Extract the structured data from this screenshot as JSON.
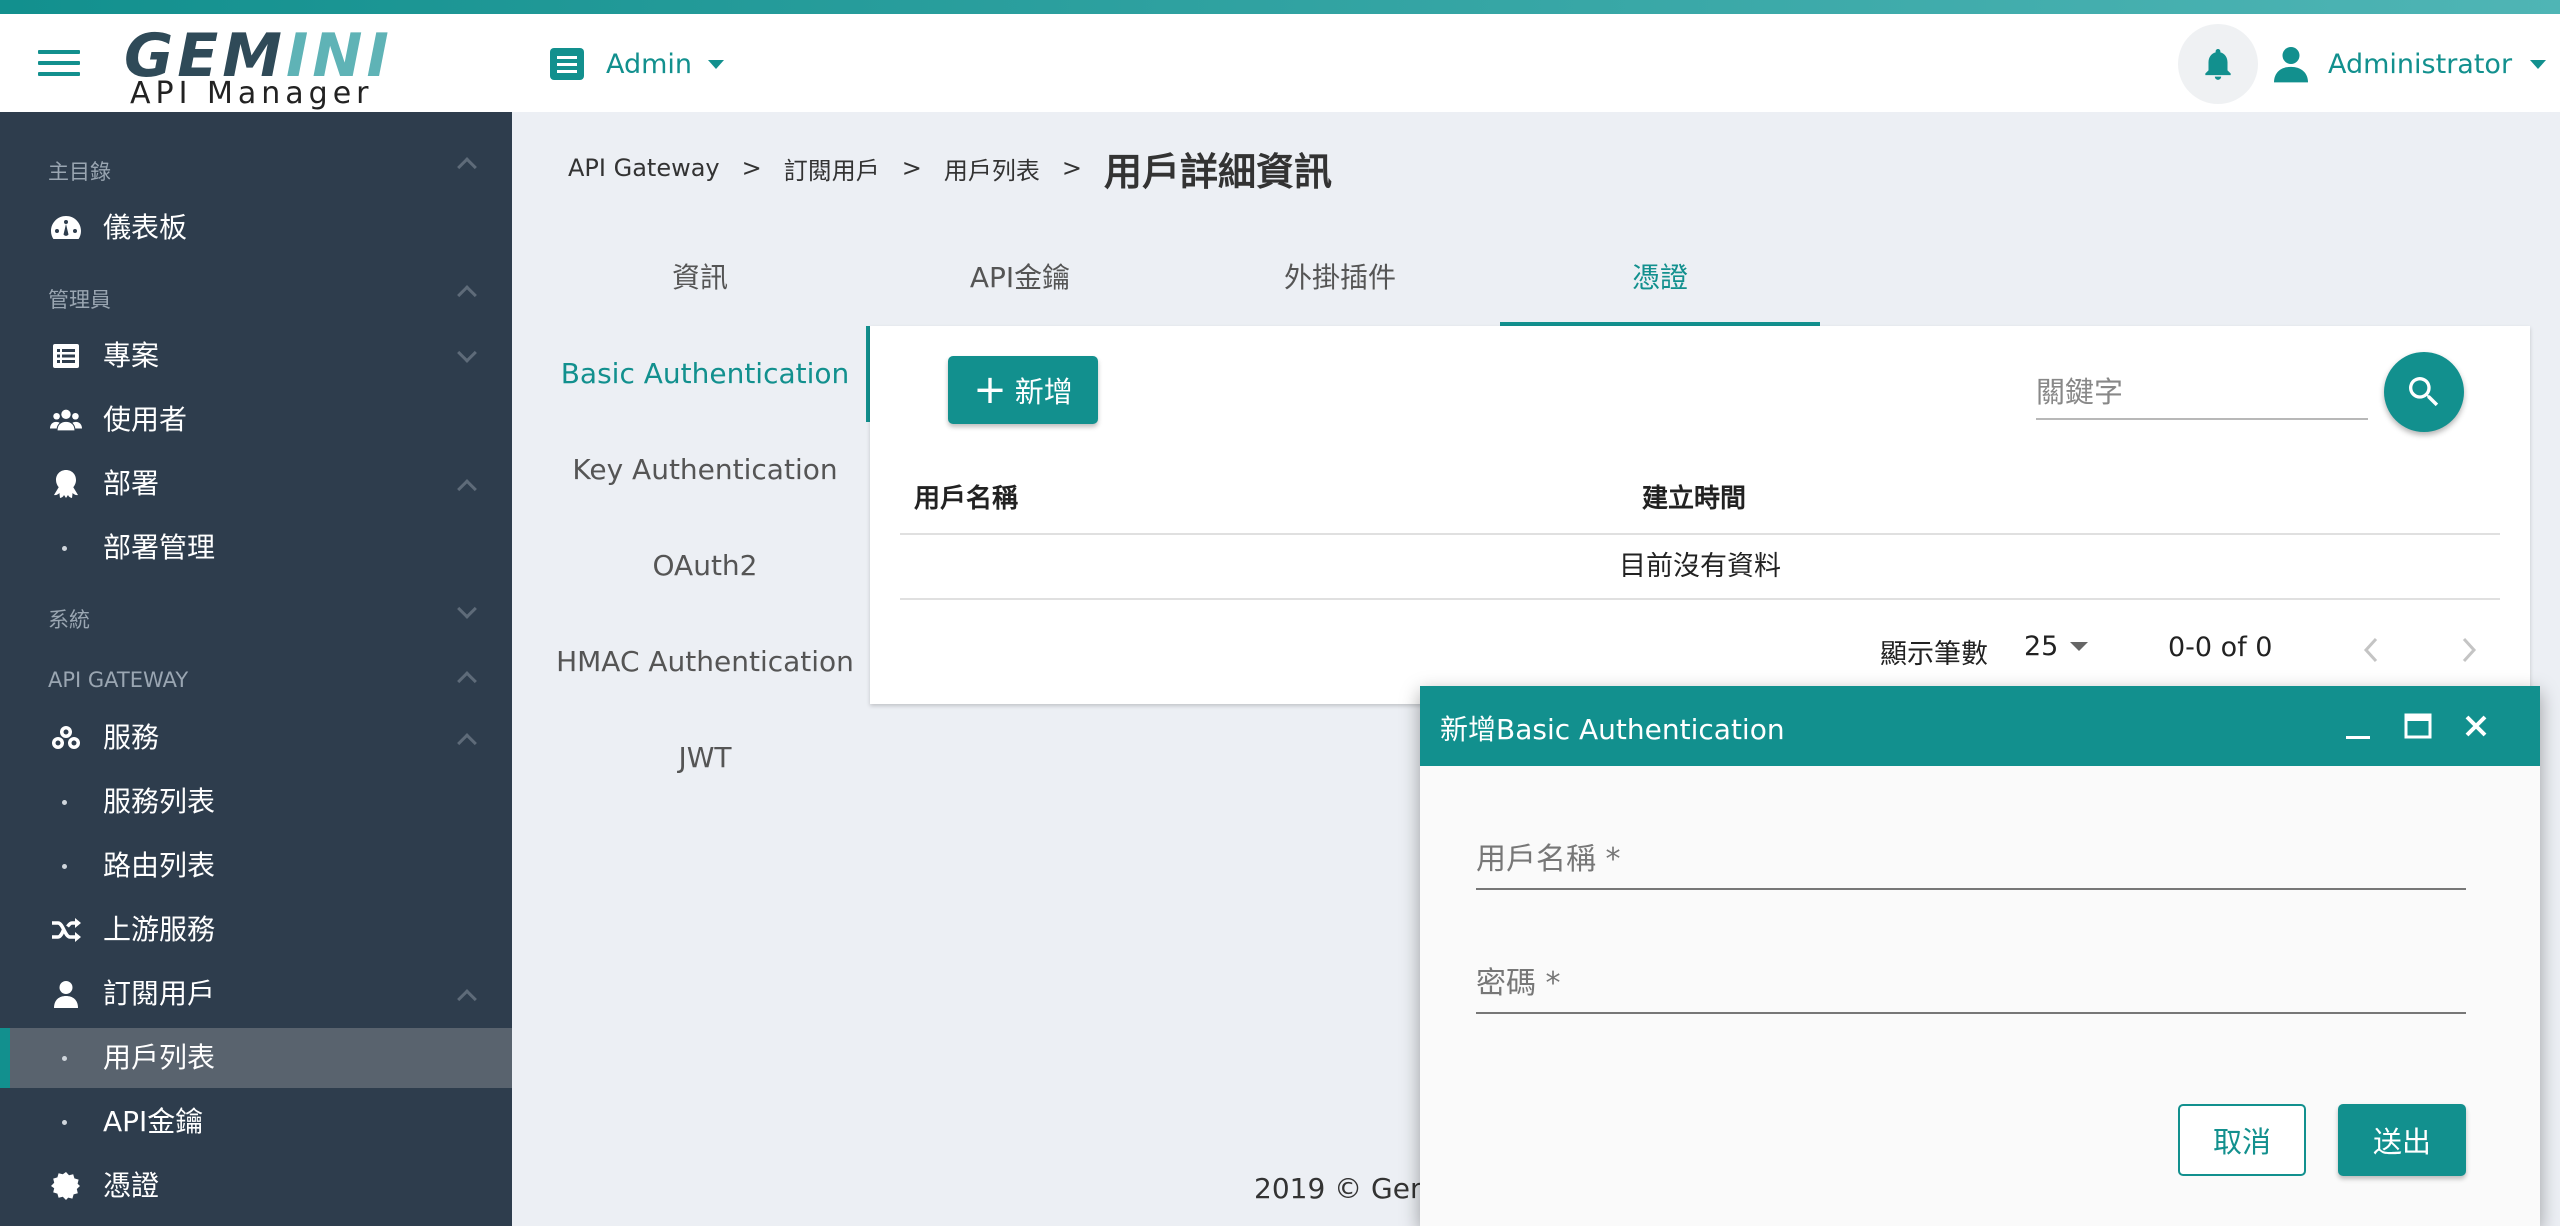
{
  "app": {
    "logo_main": "GEMINI",
    "logo_sub": "API Manager",
    "accent_color": "#12908e",
    "sidebar_bg": "#2e3d4d"
  },
  "header": {
    "project_label": "Admin",
    "user_label": "Administrator",
    "icons": {
      "menu": "hamburger-icon",
      "project": "list-icon",
      "notifications": "bell-icon",
      "user": "user-icon"
    }
  },
  "sidebar": {
    "sections": {
      "main": "主目錄",
      "admin": "管理員",
      "system": "系統",
      "gateway": "API GATEWAY"
    },
    "items": {
      "dashboard": "儀表板",
      "projects": "專案",
      "users": "使用者",
      "deploy": "部署",
      "deploy_manage": "部署管理",
      "services": "服務",
      "service_list": "服務列表",
      "route_list": "路由列表",
      "upstream": "上游服務",
      "consumers": "訂閱用戶",
      "consumer_list": "用戶列表",
      "api_keys": "API金鑰",
      "credentials": "憑證"
    },
    "active_item": "用戶列表"
  },
  "breadcrumb": {
    "items": [
      "API Gateway",
      "訂閱用戶",
      "用戶列表"
    ],
    "separator": ">",
    "current": "用戶詳細資訊"
  },
  "tabs": {
    "items": [
      "資訊",
      "API金鑰",
      "外掛插件",
      "憑證"
    ],
    "active": "憑證"
  },
  "auth_tabs": {
    "items": [
      "Basic Authentication",
      "Key Authentication",
      "OAuth2",
      "HMAC Authentication",
      "JWT"
    ],
    "active": "Basic Authentication"
  },
  "table": {
    "add_label": "新增",
    "search_placeholder": "關鍵字",
    "columns": [
      "用戶名稱",
      "建立時間"
    ],
    "empty_text": "目前沒有資料",
    "rows_per_page_label": "顯示筆數",
    "rows_per_page_value": "25",
    "range_text": "0-0 of 0"
  },
  "footer": {
    "text": "2019 © Gem"
  },
  "dialog": {
    "title": "新增Basic Authentication",
    "username_placeholder": "用戶名稱 *",
    "password_placeholder": "密碼 *",
    "cancel_label": "取消",
    "submit_label": "送出"
  }
}
